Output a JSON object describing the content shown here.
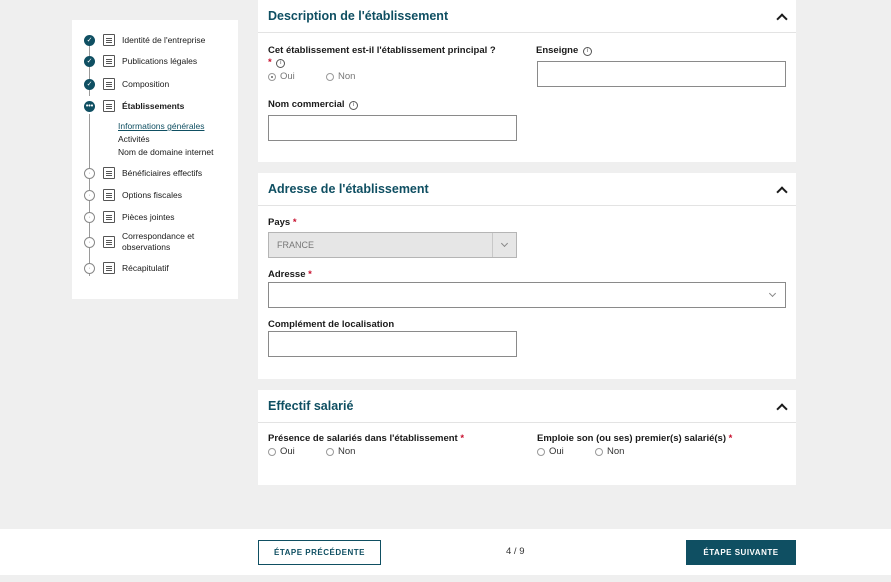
{
  "sidebar": {
    "steps": [
      {
        "label": "Identité de l'entreprise",
        "state": "done"
      },
      {
        "label": "Publications légales",
        "state": "done"
      },
      {
        "label": "Composition",
        "state": "done"
      },
      {
        "label": "Établissements",
        "state": "current"
      },
      {
        "label": "Bénéficiaires effectifs",
        "state": "todo"
      },
      {
        "label": "Options fiscales",
        "state": "todo"
      },
      {
        "label": "Pièces jointes",
        "state": "todo"
      },
      {
        "label": "Correspondance et observations",
        "state": "todo"
      },
      {
        "label": "Récapitulatif",
        "state": "todo"
      }
    ],
    "substeps": [
      "Informations générales",
      "Activités",
      "Nom de domaine internet"
    ]
  },
  "description": {
    "title": "Description de l'établissement",
    "principal_question": "Cet établissement est-il l'établissement principal ?",
    "yes": "Oui",
    "no": "Non",
    "enseigne_label": "Enseigne",
    "nom_commercial_label": "Nom commercial"
  },
  "adresse": {
    "title": "Adresse de l'établissement",
    "pays_label": "Pays",
    "pays_value": "FRANCE",
    "adresse_label": "Adresse",
    "complement_label": "Complément de localisation"
  },
  "effectif": {
    "title": "Effectif salarié",
    "presence_label": "Présence de salariés dans l'établissement",
    "emploie_label": "Emploie son (ou ses) premier(s) salarié(s)",
    "yes": "Oui",
    "no": "Non"
  },
  "footer": {
    "prev_label": "ÉTAPE PRÉCÉDENTE",
    "next_label": "ÉTAPE SUIVANTE",
    "pager": "4 / 9"
  },
  "required_mark": "*",
  "info_glyph": "i",
  "colors": {
    "accent": "#0f4f62",
    "required": "#c8102e"
  }
}
